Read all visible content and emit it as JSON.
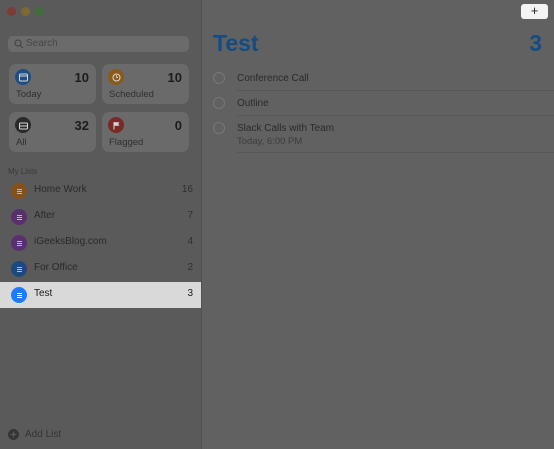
{
  "sidebar": {
    "search": {
      "placeholder": "Search"
    },
    "smart_lists": [
      {
        "label": "Today",
        "count": "10",
        "icon": "calendar-icon",
        "color": "#1e4f86"
      },
      {
        "label": "Scheduled",
        "count": "10",
        "icon": "clock-icon",
        "color": "#8a5a1a"
      },
      {
        "label": "All",
        "count": "32",
        "icon": "tray-icon",
        "color": "#2a2a2a"
      },
      {
        "label": "Flagged",
        "count": "0",
        "icon": "flag-icon",
        "color": "#7a2a26"
      }
    ],
    "section_label": "My Lists",
    "lists": [
      {
        "label": "Home Work",
        "count": "16",
        "color": "#86501b"
      },
      {
        "label": "After",
        "count": "7",
        "color": "#5a2f6f"
      },
      {
        "label": "iGeeksBlog.com",
        "count": "4",
        "color": "#5a2f6f"
      },
      {
        "label": "For Office",
        "count": "2",
        "color": "#1d4a7d"
      },
      {
        "label": "Test",
        "count": "3",
        "color": "#1e7bff"
      }
    ],
    "add_list": "Add List"
  },
  "toolbar": {
    "add_label": "+"
  },
  "main": {
    "title": "Test",
    "count": "3",
    "tasks": [
      {
        "title": "Conference Call",
        "subtitle": ""
      },
      {
        "title": "Outline",
        "subtitle": ""
      },
      {
        "title": "Slack Calls with Team",
        "subtitle": "Today, 6:00 PM"
      }
    ]
  }
}
